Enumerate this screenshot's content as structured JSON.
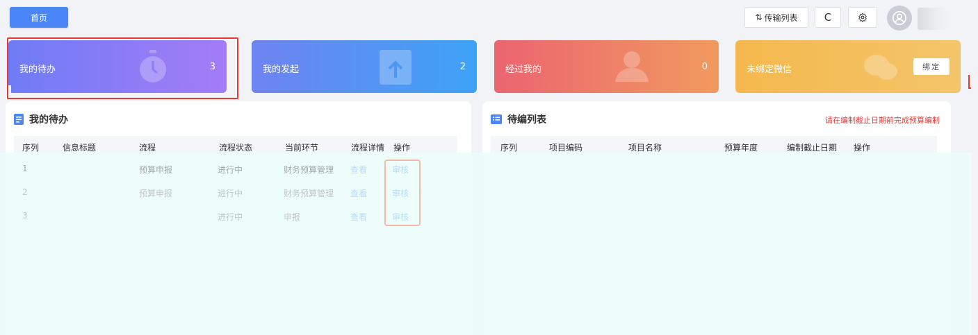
{
  "topbar": {
    "home_label": "首页",
    "transfer_label": "传输列表",
    "refresh_glyph": "C",
    "settings_glyph": "⚙"
  },
  "cards": {
    "todo": {
      "label": "我的待办",
      "count": "3"
    },
    "started": {
      "label": "我的发起",
      "count": "2"
    },
    "passed": {
      "label": "经过我的",
      "count": "0"
    },
    "wechat": {
      "label": "未绑定微信",
      "button": "绑定"
    }
  },
  "todo_panel": {
    "title": "我的待办",
    "columns": [
      "序列",
      "信息标题",
      "流程",
      "流程状态",
      "当前环节",
      "流程详情",
      "操作"
    ],
    "rows": [
      {
        "seq": "1",
        "title": "",
        "flow": "预算申报",
        "status": "进行中",
        "stage": "财务预算管理",
        "detail": "查看",
        "action": "审核"
      },
      {
        "seq": "2",
        "title": "",
        "flow": "预算申报",
        "status": "进行中",
        "stage": "财务预算管理",
        "detail": "查看",
        "action": "审核"
      },
      {
        "seq": "3",
        "title": "",
        "flow": "",
        "status": "进行中",
        "stage": "申报",
        "detail": "查看",
        "action": "审核"
      }
    ]
  },
  "edit_panel": {
    "title": "待编列表",
    "notice": "请在编制截止日期前完成预算编制",
    "columns": [
      "序列",
      "项目编码",
      "项目名称",
      "预算年度",
      "编制截止日期",
      "操作"
    ]
  },
  "colors": {
    "primary": "#4a86f7",
    "notice_red": "#e53935",
    "mask": "#ecfdfa"
  }
}
